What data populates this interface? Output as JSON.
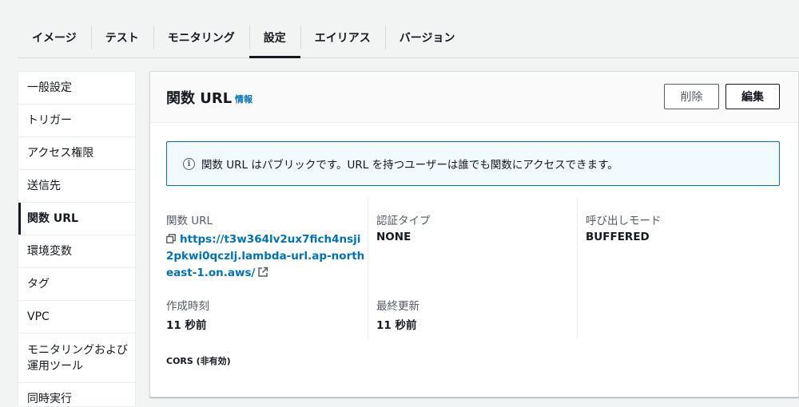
{
  "tabs": [
    {
      "label": "イメージ"
    },
    {
      "label": "テスト"
    },
    {
      "label": "モニタリング"
    },
    {
      "label": "設定",
      "active": true
    },
    {
      "label": "エイリアス"
    },
    {
      "label": "バージョン"
    }
  ],
  "sidenav": {
    "items": [
      {
        "label": "一般設定"
      },
      {
        "label": "トリガー"
      },
      {
        "label": "アクセス権限"
      },
      {
        "label": "送信先"
      },
      {
        "label": "関数 URL",
        "active": true
      },
      {
        "label": "環境変数"
      },
      {
        "label": "タグ"
      },
      {
        "label": "VPC"
      },
      {
        "label": "モニタリングおよび\n運用ツール"
      },
      {
        "label": "同時実行"
      }
    ]
  },
  "panel": {
    "title": "関数 URL",
    "info_link": "情報",
    "delete_label": "削除",
    "edit_label": "編集",
    "alert_text": "関数 URL はパブリックです。URL を持つユーザーは誰でも関数にアクセスできます。",
    "fields": {
      "function_url_label": "関数 URL",
      "function_url_value": "https://t3w364lv2ux7fich4nsji2pkwi0qczlj.lambda-url.ap-northeast-1.on.aws/",
      "auth_type_label": "認証タイプ",
      "auth_type_value": "NONE",
      "invoke_mode_label": "呼び出しモード",
      "invoke_mode_value": "BUFFERED",
      "created_label": "作成時刻",
      "created_value": "11 秒前",
      "updated_label": "最終更新",
      "updated_value": "11 秒前"
    },
    "cors_label": "CORS (非有効)"
  },
  "colors": {
    "link": "#0073bb",
    "alert_border": "#0073bb",
    "alert_bg": "#f1faff"
  }
}
